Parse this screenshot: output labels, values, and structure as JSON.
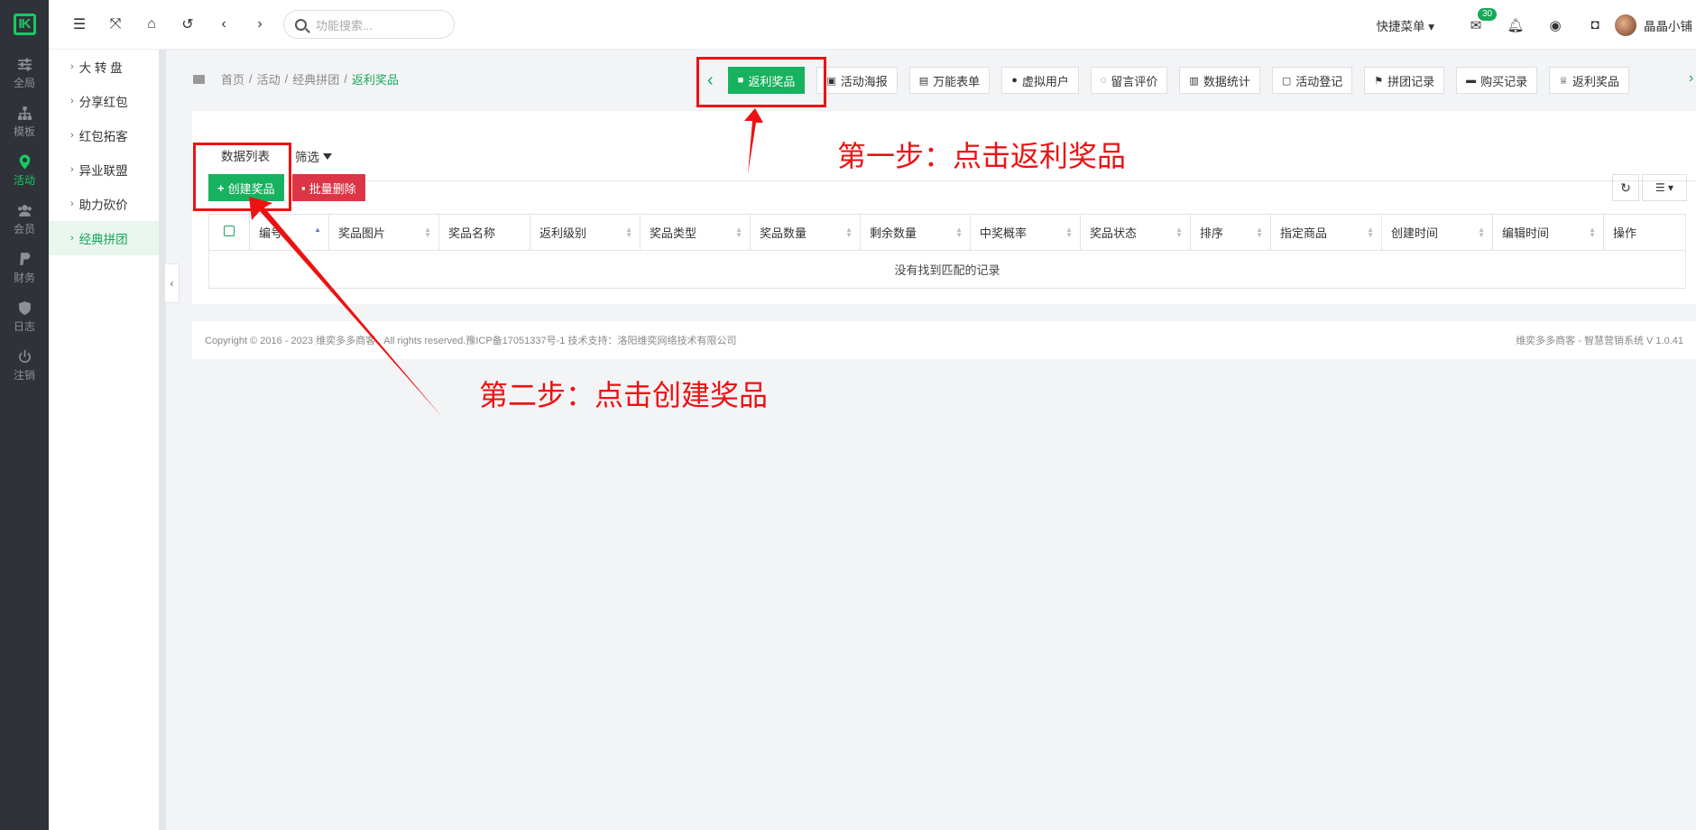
{
  "rail": {
    "logo": "IK",
    "items": [
      {
        "label": "全局",
        "icon": "sliders-icon"
      },
      {
        "label": "模板",
        "icon": "sitemap-icon"
      },
      {
        "label": "活动",
        "icon": "map-pin-icon"
      },
      {
        "label": "会员",
        "icon": "users-icon"
      },
      {
        "label": "财务",
        "icon": "paypal-icon"
      },
      {
        "label": "日志",
        "icon": "shield-icon"
      },
      {
        "label": "注销",
        "icon": "power-icon"
      }
    ]
  },
  "subnav": {
    "items": [
      "大 转 盘",
      "分享红包",
      "红包拓客",
      "异业联盟",
      "助力砍价",
      "经典拼团"
    ]
  },
  "topbar": {
    "search_placeholder": "功能搜索...",
    "quick_menu": "快捷菜单",
    "mail_badge": "30",
    "username": "晶晶小铺"
  },
  "breadcrumb": {
    "items": [
      "首页",
      "活动",
      "经典拼团"
    ],
    "current": "返利奖品"
  },
  "page_tabs": [
    "返利奖品",
    "活动海报",
    "万能表单",
    "虚拟用户",
    "留言评价",
    "数据统计",
    "活动登记",
    "拼团记录",
    "购买记录",
    "返利奖品"
  ],
  "panel": {
    "tabs": [
      "数据列表",
      "筛选"
    ],
    "create_button": "创建奖品",
    "delete_button": "批量删除",
    "columns": [
      "编号",
      "奖品图片",
      "奖品名称",
      "返利级别",
      "奖品类型",
      "奖品数量",
      "剩余数量",
      "中奖概率",
      "奖品状态",
      "排序",
      "指定商品",
      "创建时间",
      "编辑时间",
      "操作"
    ],
    "empty_text": "没有找到匹配的记录"
  },
  "footer": {
    "left": "Copyright © 2016 - 2023 维奕多多商客 . All rights reserved.豫ICP备17051337号-1 技术支持：洛阳维奕网络技术有限公司",
    "right": "维奕多多商客 - 智慧营销系统 V 1.0.41"
  },
  "annotations": {
    "step1": "第一步：点击返利奖品",
    "step2": "第二步：点击创建奖品",
    "color": "#ee1111"
  },
  "colors": {
    "accent": "#17a858",
    "danger": "#dc3545",
    "rail": "#2f3339"
  }
}
